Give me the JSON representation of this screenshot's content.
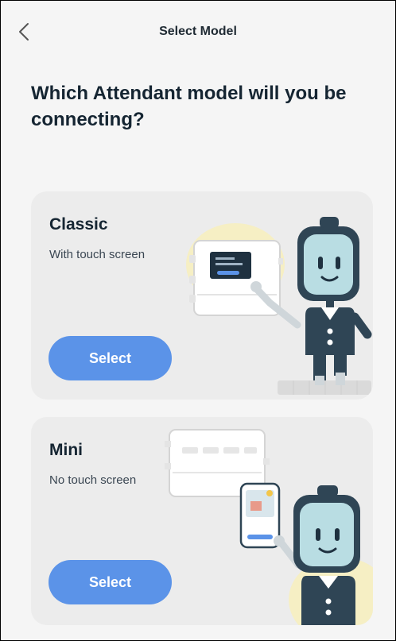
{
  "header": {
    "title": "Select Model",
    "back_icon": "chevron-left-icon"
  },
  "heading": "Which Attendant model will you be connecting?",
  "models": [
    {
      "name": "Classic",
      "description": "With touch screen",
      "button_label": "Select",
      "illustration": "robot-with-touchscreen-device"
    },
    {
      "name": "Mini",
      "description": "No touch screen",
      "button_label": "Select",
      "illustration": "robot-with-phone-and-device"
    }
  ],
  "colors": {
    "background": "#f5f5f5",
    "card": "#ececec",
    "button": "#5b93e8",
    "text_dark": "#152532",
    "robot_dark": "#2f4555",
    "robot_screen": "#b9dde3",
    "accent_yellow": "#f6efc4"
  }
}
